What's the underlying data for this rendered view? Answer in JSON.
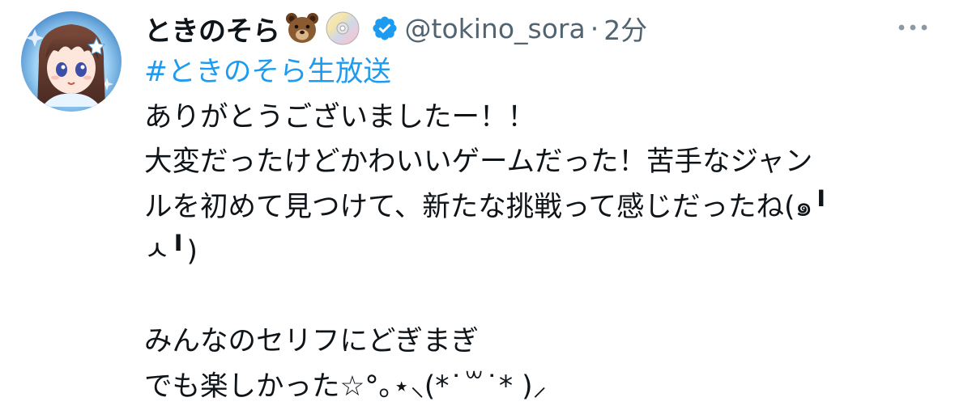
{
  "tweet": {
    "display_name": "ときのそら",
    "name_emojis": [
      "bear-emoji",
      "dvd-disc-emoji"
    ],
    "verified_icon": "verified-badge-icon",
    "handle": "@tokino_sora",
    "separator": "·",
    "time": "2分",
    "more_icon": "more-options-icon",
    "hashtag": "#ときのそら生放送",
    "body_lines": [
      "ありがとうございましたー！！",
      "大変だったけどかわいいゲームだった！苦手なジャン",
      "ルを初めて見つけて、新たな挑戦って感じだったね(๑╹",
      "ㅅ╹)",
      "",
      "みんなのセリフにどぎまぎ",
      "でも楽しかった☆°｡⋆⸜(*˙꒳˙* )⸝"
    ]
  },
  "colors": {
    "text": "#0f1419",
    "secondary": "#536471",
    "link": "#1d9bf0",
    "verified": "#1d9bf0"
  }
}
